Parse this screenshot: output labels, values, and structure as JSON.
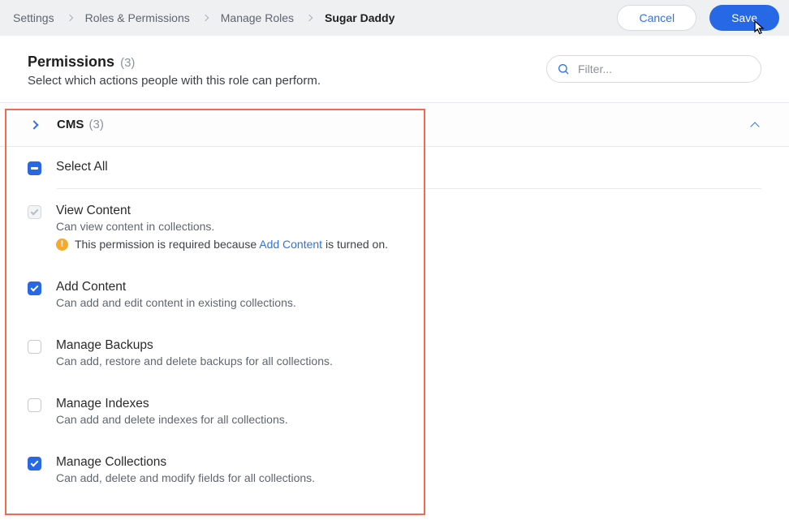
{
  "breadcrumbs": {
    "items": [
      {
        "label": "Settings"
      },
      {
        "label": "Roles & Permissions"
      },
      {
        "label": "Manage Roles"
      },
      {
        "label": "Sugar Daddy"
      }
    ]
  },
  "actions": {
    "cancel": "Cancel",
    "save": "Save"
  },
  "header": {
    "title": "Permissions",
    "count": "(3)",
    "subtitle": "Select which actions people with this role can perform."
  },
  "filter": {
    "placeholder": "Filter..."
  },
  "section": {
    "title": "CMS",
    "count": "(3)"
  },
  "select_all": {
    "label": "Select All"
  },
  "permissions": [
    {
      "title": "View Content",
      "desc": "Can view content in collections.",
      "state": "locked",
      "note_prefix": "This permission is required because ",
      "note_link": "Add Content",
      "note_suffix": " is turned on."
    },
    {
      "title": "Add Content",
      "desc": "Can add and edit content in existing collections.",
      "state": "checked"
    },
    {
      "title": "Manage Backups",
      "desc": "Can add, restore and delete backups for all collections.",
      "state": "unchecked"
    },
    {
      "title": "Manage Indexes",
      "desc": "Can add and delete indexes for all collections.",
      "state": "unchecked"
    },
    {
      "title": "Manage Collections",
      "desc": "Can add, delete and modify fields for all collections.",
      "state": "checked"
    }
  ]
}
